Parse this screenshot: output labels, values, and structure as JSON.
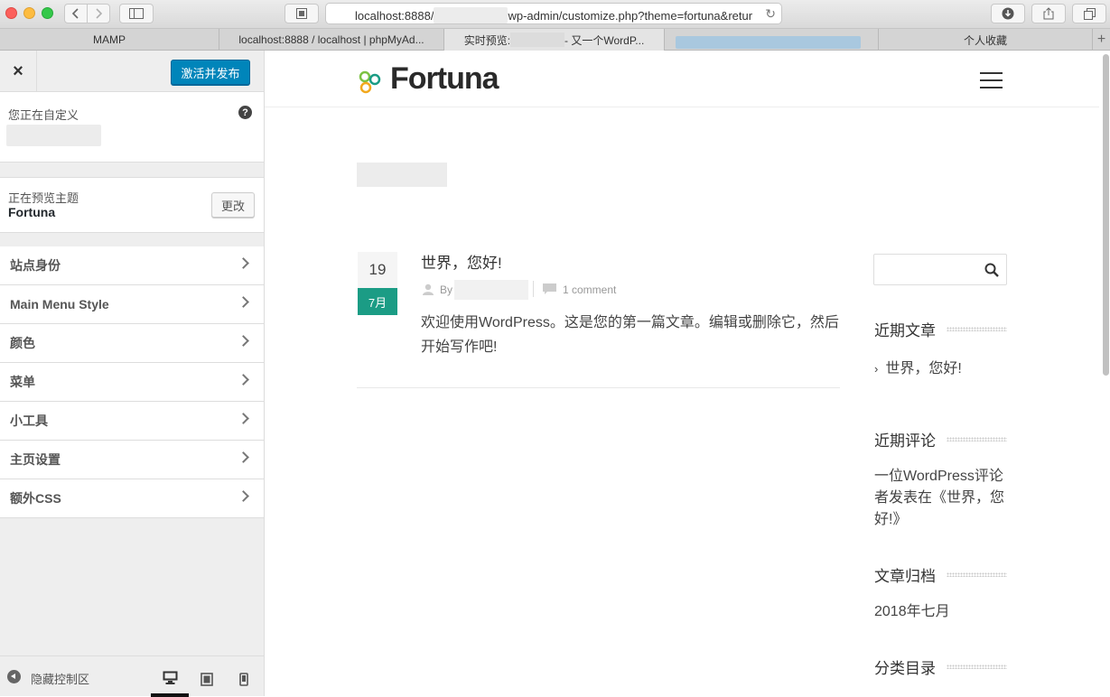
{
  "browser": {
    "url_prefix": "localhost:8888/",
    "url_suffix": "wp-admin/customize.php?theme=fortuna&retur",
    "tabs": [
      {
        "label": "MAMP"
      },
      {
        "label": "localhost:8888 / localhost | phpMyAd..."
      },
      {
        "label_prefix": "实时预览:",
        "label_suffix": "- 又一个WordP..."
      },
      {
        "label": ""
      },
      {
        "label": "个人收藏"
      }
    ],
    "new_tab": "+"
  },
  "sidebar": {
    "close": "×",
    "publish_label": "激活并发布",
    "customizing_label": "您正在自定义",
    "help": "?",
    "previewing_label": "正在预览主题",
    "theme_name": "Fortuna",
    "change_label": "更改",
    "items": [
      {
        "label": "站点身份"
      },
      {
        "label": "Main Menu Style"
      },
      {
        "label": "颜色"
      },
      {
        "label": "菜单"
      },
      {
        "label": "小工具"
      },
      {
        "label": "主页设置"
      },
      {
        "label": "额外CSS"
      }
    ],
    "hide_label": "隐藏控制区"
  },
  "preview": {
    "logo_text": "Fortuna",
    "post": {
      "day": "19",
      "month": "7月",
      "title": "世界，您好!",
      "by": "By",
      "comments": "1 comment",
      "excerpt": "欢迎使用WordPress。这是您的第一篇文章。编辑或删除它，然后开始写作吧!"
    },
    "widgets": {
      "recent_posts_title": "近期文章",
      "recent_post_item": "世界，您好!",
      "recent_comments_title": "近期评论",
      "recent_comment_text": "一位WordPress评论者发表在《世界，您好!》",
      "archives_title": "文章归档",
      "archive_item": "2018年七月",
      "categories_title": "分类目录"
    }
  },
  "colors": {
    "accent": "#1b9c85",
    "publish_button": "#0085ba"
  }
}
